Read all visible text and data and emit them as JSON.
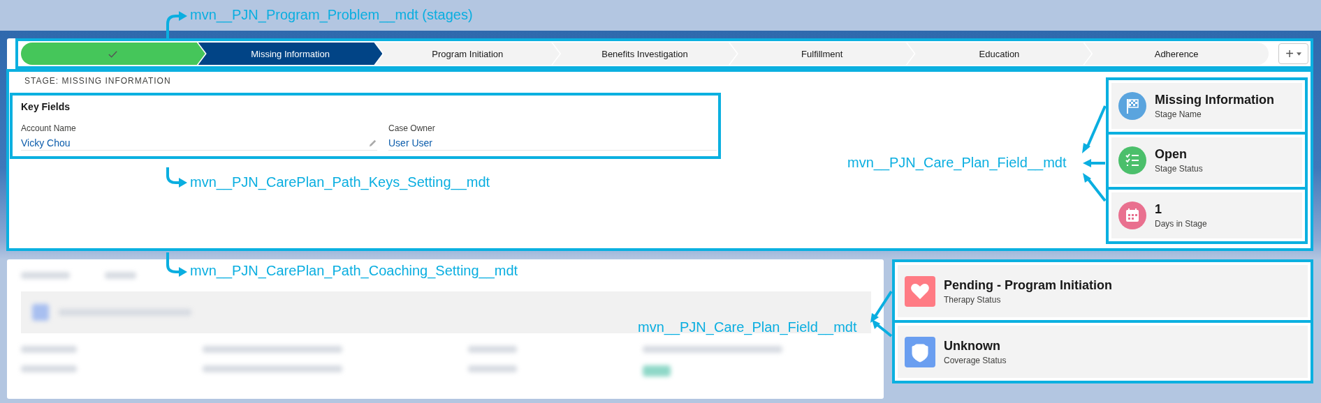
{
  "path": {
    "stages": [
      {
        "complete": true,
        "selected": false
      },
      {
        "label": "Missing Information",
        "complete": false,
        "selected": true
      },
      {
        "label": "Program Initiation",
        "complete": false,
        "selected": false
      },
      {
        "label": "Benefits Investigation",
        "complete": false,
        "selected": false
      },
      {
        "label": "Fulfillment",
        "complete": false,
        "selected": false
      },
      {
        "label": "Education",
        "complete": false,
        "selected": false
      },
      {
        "label": "Adherence",
        "complete": false,
        "selected": false
      }
    ],
    "add_button": "+"
  },
  "stage_heading": "STAGE: MISSING INFORMATION",
  "key_fields": {
    "title": "Key Fields",
    "fields": [
      {
        "label": "Account Name",
        "value": "Vicky Chou",
        "editable": true
      },
      {
        "label": "Case Owner",
        "value": "User User",
        "editable": false
      }
    ]
  },
  "stage_cards": [
    {
      "value": "Missing Information",
      "label": "Stage Name",
      "kind": "flag",
      "color": "#5aa4de"
    },
    {
      "value": "Open",
      "label": "Stage Status",
      "kind": "checklist",
      "color": "#4bbf6b"
    },
    {
      "value": "1",
      "label": "Days in Stage",
      "kind": "calendar",
      "color": "#e9708f"
    }
  ],
  "status_cards": [
    {
      "value": "Pending - Program Initiation",
      "label": "Therapy Status",
      "kind": "heart",
      "color": "#ff7b84"
    },
    {
      "value": "Unknown",
      "label": "Coverage Status",
      "kind": "shield",
      "color": "#6a9ef0"
    }
  ],
  "annotations": [
    "mvn__PJN_Program_Problem__mdt (stages)",
    "mvn__PJN_CarePlan_Path_Keys_Setting__mdt",
    "mvn__PJN_CarePlan_Path_Coaching_Setting__mdt",
    "mvn__PJN_Care_Plan_Field__mdt",
    "mvn__PJN_Care_Plan_Field__mdt"
  ]
}
